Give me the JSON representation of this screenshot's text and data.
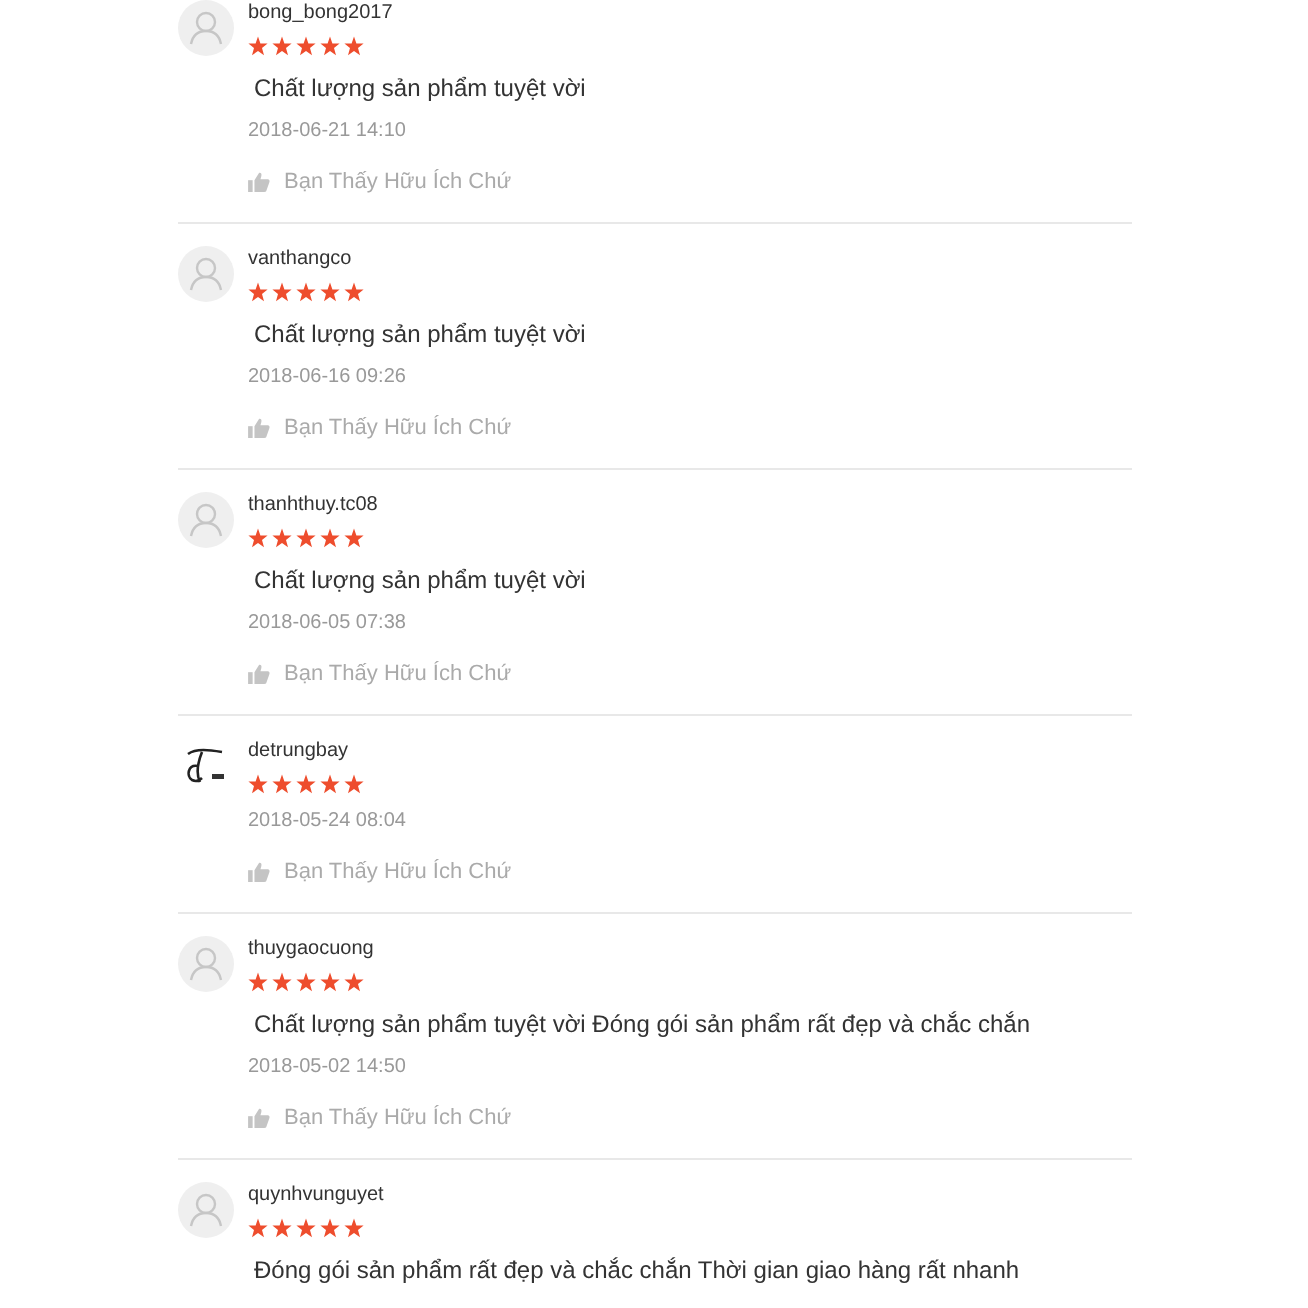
{
  "reviews": [
    {
      "username": "bong_bong2017",
      "kind": "default",
      "stars": 5,
      "comment": "Chất lượng sản phẩm tuyệt vời",
      "date": "2018-06-21 14:10",
      "helpful": "Bạn Thấy Hữu Ích Chứ"
    },
    {
      "username": "vanthangco",
      "kind": "default",
      "stars": 5,
      "comment": "Chất lượng sản phẩm tuyệt vời",
      "date": "2018-06-16 09:26",
      "helpful": "Bạn Thấy Hữu Ích Chứ"
    },
    {
      "username": "thanhthuy.tc08",
      "kind": "default",
      "stars": 5,
      "comment": "Chất lượng sản phẩm tuyệt vời",
      "date": "2018-06-05 07:38",
      "helpful": "Bạn Thấy Hữu Ích Chứ"
    },
    {
      "username": "detrungbay",
      "kind": "logo",
      "stars": 5,
      "date": "2018-05-24 08:04",
      "helpful": "Bạn Thấy Hữu Ích Chứ"
    },
    {
      "username": "thuygaocuong",
      "kind": "default",
      "stars": 5,
      "comment": "Chất lượng sản phẩm tuyệt vời Đóng gói sản phẩm rất đẹp và chắc chắn",
      "date": "2018-05-02 14:50",
      "helpful": "Bạn Thấy Hữu Ích Chứ"
    },
    {
      "username": "quynhvunguyet",
      "kind": "default",
      "stars": 5,
      "comment": "Đóng gói sản phẩm rất đẹp và chắc chắn Thời gian giao hàng rất nhanh"
    }
  ]
}
